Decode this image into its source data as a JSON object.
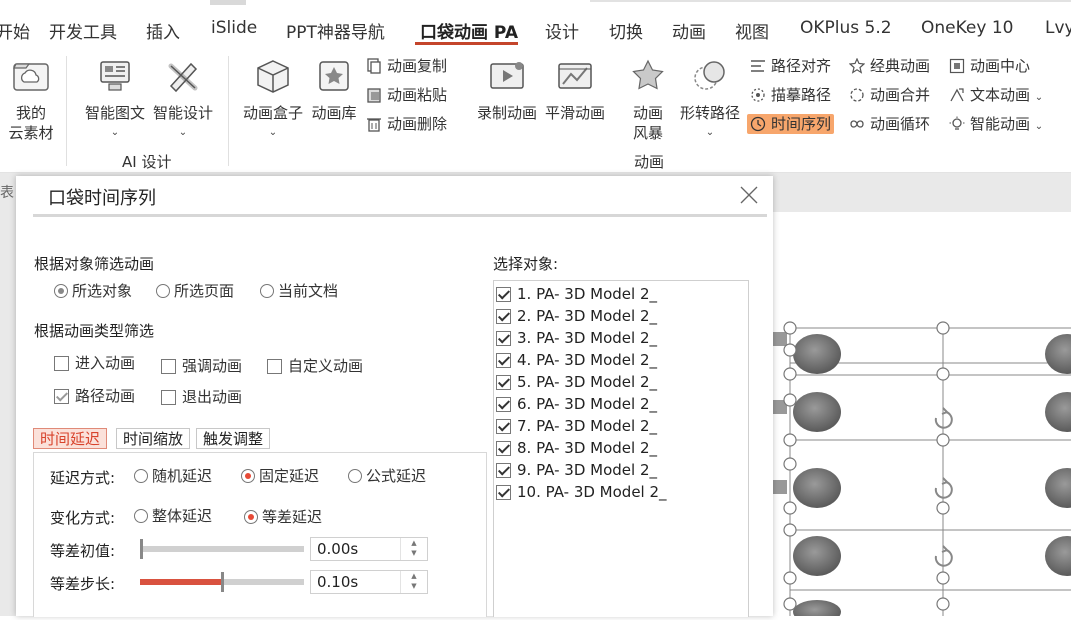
{
  "tabs": [
    {
      "label": "开始",
      "active": false
    },
    {
      "label": "开发工具",
      "active": false
    },
    {
      "label": "插入",
      "active": false
    },
    {
      "label": "iSlide",
      "active": false
    },
    {
      "label": "PPT神器导航",
      "active": false
    },
    {
      "label": "口袋动画 PA",
      "active": true
    },
    {
      "label": "设计",
      "active": false
    },
    {
      "label": "切换",
      "active": false
    },
    {
      "label": "动画",
      "active": false
    },
    {
      "label": "视图",
      "active": false
    },
    {
      "label": "OKPlus 5.2",
      "active": false
    },
    {
      "label": "OneKey 10",
      "active": false
    },
    {
      "label": "Lvy",
      "active": false
    }
  ],
  "ribbon": {
    "cloud": {
      "line1": "我的",
      "line2": "云素材"
    },
    "smart_graphic": "智能图文",
    "smart_design": "智能设计",
    "group_ai": "AI 设计",
    "anim_box": "动画盒子",
    "anim_lib": "动画库",
    "anim_copy": "动画复制",
    "anim_paste": "动画粘贴",
    "anim_delete": "动画删除",
    "record_anim": "录制动画",
    "smooth_anim": "平滑动画",
    "anim_storm": {
      "line1": "动画",
      "line2": "风暴"
    },
    "morph_path": "形转路径",
    "path_align": "路径对齐",
    "trace_path": "描摹路径",
    "time_seq": "时间序列",
    "classic_anim": "经典动画",
    "anim_merge": "动画合并",
    "anim_loop": "动画循环",
    "anim_center": "动画中心",
    "text_anim": "文本动画",
    "smart_anim": "智能动画",
    "group_anim": "动画",
    "caret": "⌄",
    "accent": "#f7a66c"
  },
  "left_stub": "表",
  "dialog": {
    "title": "口袋时间序列",
    "close_glyph": "✕",
    "filter_by_object": {
      "label": "根据对象筛选动画",
      "options": [
        "所选对象",
        "所选页面",
        "当前文档"
      ],
      "selected": 0
    },
    "filter_by_type": {
      "label": "根据动画类型筛选",
      "options": [
        {
          "label": "进入动画",
          "checked": false
        },
        {
          "label": "强调动画",
          "checked": false
        },
        {
          "label": "自定义动画",
          "checked": false
        },
        {
          "label": "路径动画",
          "checked": true
        },
        {
          "label": "退出动画",
          "checked": false
        }
      ]
    },
    "subtabs": [
      "时间延迟",
      "时间缩放",
      "触发调整"
    ],
    "active_subtab": 0,
    "delay_mode": {
      "label": "延迟方式:",
      "options": [
        "随机延迟",
        "固定延迟",
        "公式延迟"
      ],
      "selected": 1
    },
    "change_mode": {
      "label": "变化方式:",
      "options": [
        "整体延迟",
        "等差延迟"
      ],
      "selected": 1
    },
    "initial_value": {
      "label": "等差初值:",
      "value": "0.00s",
      "level": 0.0
    },
    "step": {
      "label": "等差步长:",
      "value": "0.10s",
      "level": 0.5
    },
    "select_objects": {
      "label": "选择对象:",
      "items": [
        "1. PA- 3D Model 2_",
        "2. PA- 3D Model 2_",
        "3. PA- 3D Model 2_",
        "4. PA- 3D Model 2_",
        "5. PA- 3D Model 2_",
        "6. PA- 3D Model 2_",
        "7. PA- 3D Model 2_",
        "8. PA- 3D Model 2_",
        "9. PA- 3D Model 2_",
        "10. PA- 3D Model 2_"
      ]
    },
    "accent": "#e64a36"
  }
}
